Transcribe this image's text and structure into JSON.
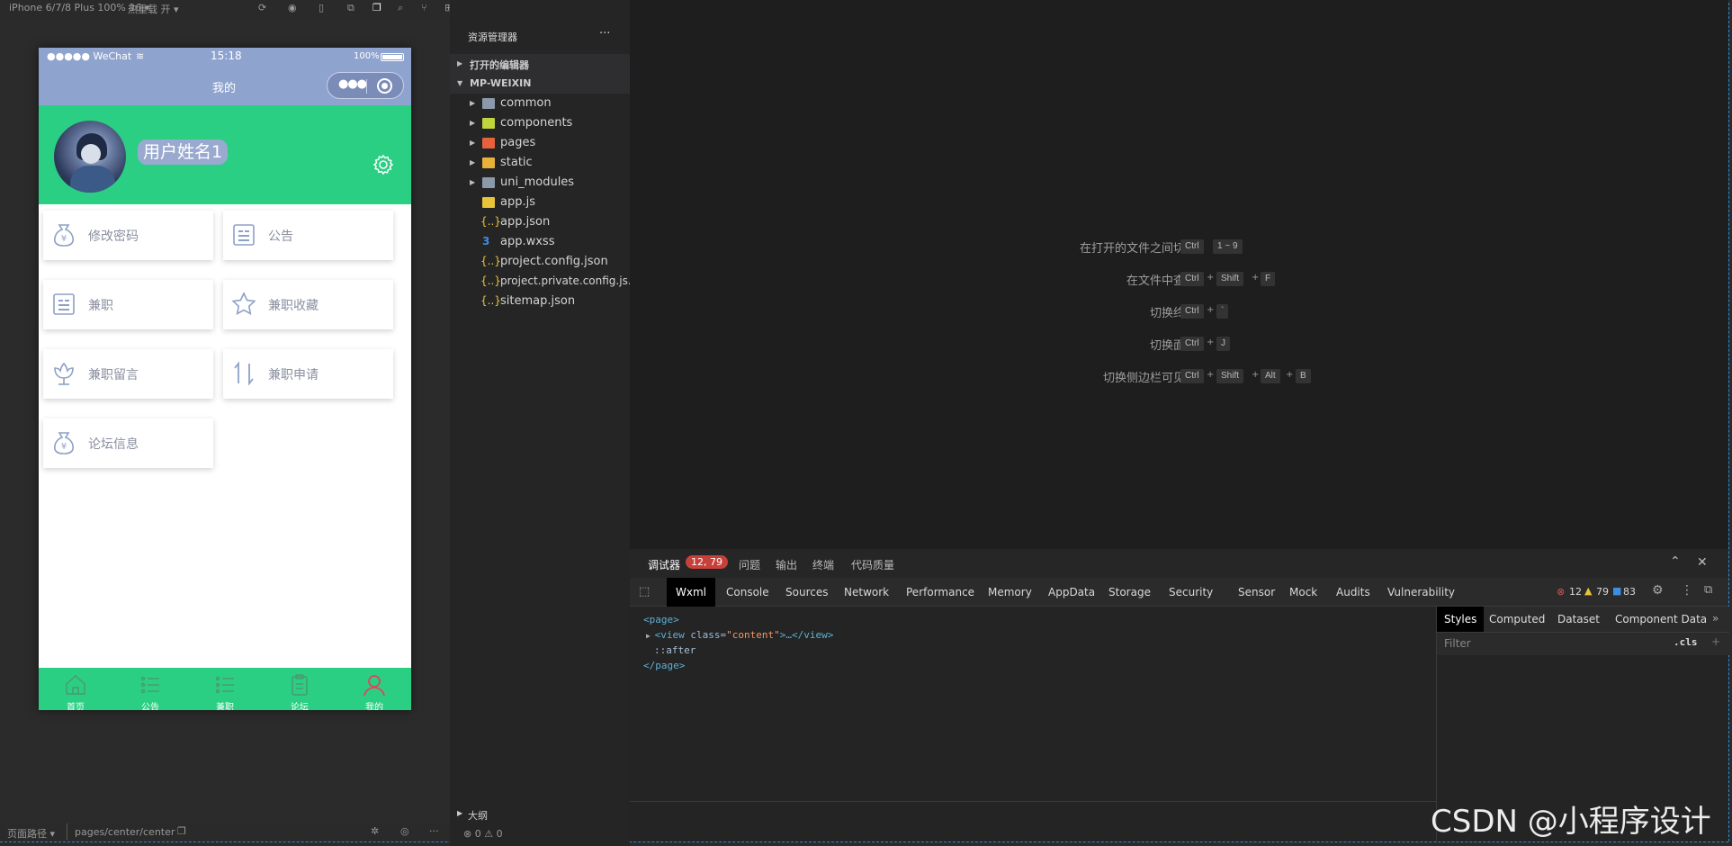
{
  "simulator_toolbar": {
    "device": "iPhone 6/7/8 Plus 100% 16 ▾",
    "hot_reload": "热重载 开 ▾"
  },
  "phone": {
    "carrier": "●●●●● WeChat",
    "time": "15:18",
    "battery": "100%",
    "nav_title": "我的",
    "username": "用户姓名1",
    "menu": [
      {
        "label": "修改密码",
        "icon": "money-bag-icon"
      },
      {
        "label": "公告",
        "icon": "notice-icon"
      },
      {
        "label": "兼职",
        "icon": "notice-icon"
      },
      {
        "label": "兼职收藏",
        "icon": "star-icon"
      },
      {
        "label": "兼职留言",
        "icon": "flower-icon"
      },
      {
        "label": "兼职申请",
        "icon": "sort-icon"
      },
      {
        "label": "论坛信息",
        "icon": "money-bag-icon"
      }
    ],
    "tabbar": [
      {
        "label": "首页",
        "icon": "home-icon"
      },
      {
        "label": "公告",
        "icon": "list-icon"
      },
      {
        "label": "兼职",
        "icon": "list-icon"
      },
      {
        "label": "论坛",
        "icon": "clipboard-icon"
      },
      {
        "label": "我的",
        "icon": "user-icon",
        "active": true
      }
    ],
    "colors": {
      "header": "#2bcf83",
      "status": "#8fa3cf",
      "tab_active": "#e0455b"
    }
  },
  "explorer": {
    "title": "资源管理器",
    "more": "···",
    "open_editors": "打开的编辑器",
    "project": "MP-WEIXIN",
    "items": [
      {
        "label": "common",
        "type": "folder"
      },
      {
        "label": "components",
        "type": "folder"
      },
      {
        "label": "pages",
        "type": "folder"
      },
      {
        "label": "static",
        "type": "folder"
      },
      {
        "label": "uni_modules",
        "type": "folder"
      },
      {
        "label": "app.js",
        "type": "js"
      },
      {
        "label": "app.json",
        "type": "json"
      },
      {
        "label": "app.wxss",
        "type": "css"
      },
      {
        "label": "project.config.json",
        "type": "json"
      },
      {
        "label": "project.private.config.js...",
        "type": "json"
      },
      {
        "label": "sitemap.json",
        "type": "json"
      }
    ],
    "outline": "大纲",
    "problems": "⊗ 0 ⚠ 0"
  },
  "shortcuts": [
    {
      "label": "在打开的文件之间切换",
      "keys": [
        "Ctrl",
        "1 ~ 9"
      ]
    },
    {
      "label": "在文件中查找",
      "keys": [
        "Ctrl",
        "Shift",
        "F"
      ]
    },
    {
      "label": "切换终端",
      "keys": [
        "Ctrl",
        "`"
      ]
    },
    {
      "label": "切换面板",
      "keys": [
        "Ctrl",
        "J"
      ]
    },
    {
      "label": "切换侧边栏可见性",
      "keys": [
        "Ctrl",
        "Shift",
        "Alt",
        "B"
      ]
    }
  ],
  "devtools": {
    "top_tabs": [
      "调试器",
      "问题",
      "输出",
      "终端",
      "代码质量"
    ],
    "badge": "12, 79",
    "tabs": [
      "Wxml",
      "Console",
      "Sources",
      "Network",
      "Performance",
      "Memory",
      "AppData",
      "Storage",
      "Security",
      "Sensor",
      "Mock",
      "Audits",
      "Vulnerability"
    ],
    "errors": "12",
    "warnings": "79",
    "infos": "83",
    "wxml_lines": {
      "l1": "<page>",
      "l2_tag": "<view",
      "l2_attr": " class=",
      "l2_val": "\"content\"",
      "l2_end": ">…</view>",
      "l3": "::after",
      "l4": "</page>"
    },
    "style_tabs": [
      "Styles",
      "Computed",
      "Dataset",
      "Component Data"
    ],
    "filter_placeholder": "Filter",
    "cls": ".cls"
  },
  "statusbar": {
    "path_label": "页面路径 ▾",
    "path": "pages/center/center"
  },
  "watermark": "CSDN @小程序设计"
}
